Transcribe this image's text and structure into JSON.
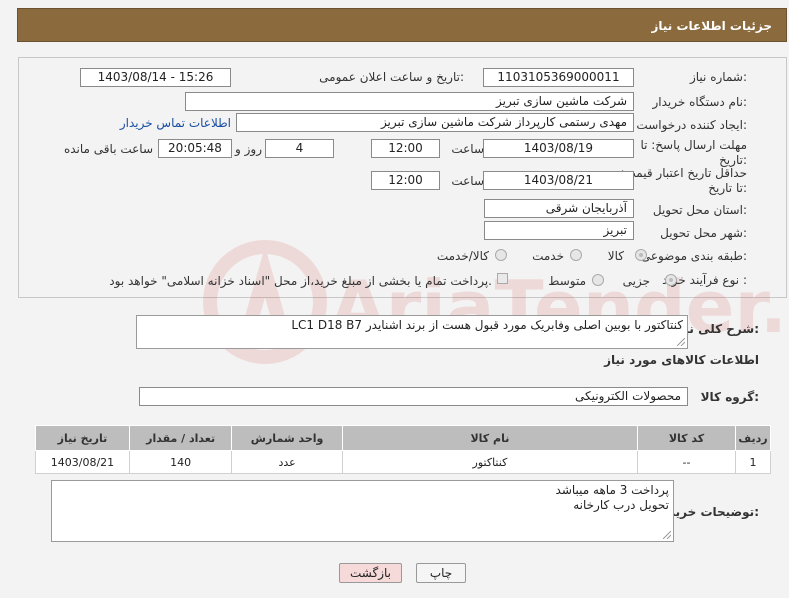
{
  "header": {
    "title": "جزئیات اطلاعات نیاز"
  },
  "form": {
    "need_number_label": "شماره نیاز:",
    "need_number": "1103105369000011",
    "announce_label": "تاریخ و ساعت اعلان عمومی:",
    "announce_value": "1403/08/14 - 15:26",
    "buyer_org_label": "نام دستگاه خریدار:",
    "buyer_org": "شرکت ماشین سازی تبریز",
    "creator_label": "ایجاد کننده درخواست:",
    "creator": "مهدی رستمی کارپرداز شرکت ماشین سازی تبریز",
    "contact_link": "اطلاعات تماس خریدار",
    "deadline_label": "مهلت ارسال پاسخ: تا تاریخ:",
    "deadline_date": "1403/08/19",
    "time_label": "ساعت",
    "deadline_time": "12:00",
    "days_value": "4",
    "days_label": "روز و",
    "remaining_value": "20:05:48",
    "remaining_label": "ساعت باقی مانده",
    "validity_label": "حداقل تاریخ اعتبار قیمت: تا تاریخ:",
    "validity_date": "1403/08/21",
    "validity_time": "12:00",
    "province_label": "استان محل تحویل:",
    "province": "آذربایجان شرقی",
    "city_label": "شهر محل تحویل:",
    "city": "تبریز",
    "category_label": "طبقه بندی موضوعی:",
    "category_options": [
      "کالا",
      "خدمت",
      "کالا/خدمت"
    ],
    "purchase_type_label": "نوع فرآیند خرید :",
    "purchase_options": [
      "جزیی",
      "متوسط"
    ],
    "treasury_text": "پرداخت تمام یا بخشی از مبلغ خرید،از محل \"اسناد خزانه اسلامی\" خواهد بود."
  },
  "description": {
    "label": "شرح کلی نیاز:",
    "text": "کنتاکتور با بوبین اصلی وفابریک مورد قبول هست از برند اشنایدر LC1 D18 B7"
  },
  "goods": {
    "section_title": "اطلاعات کالاهای مورد نیاز",
    "group_label": "گروه کالا:",
    "group_value": "محصولات الکترونیکی",
    "columns": [
      "ردیف",
      "کد کالا",
      "نام کالا",
      "واحد شمارش",
      "تعداد / مقدار",
      "تاریخ نیاز"
    ],
    "rows": [
      {
        "row": "1",
        "code": "--",
        "name": "کنتاکتور",
        "unit": "عدد",
        "qty": "140",
        "date": "1403/08/21"
      }
    ]
  },
  "buyer_notes": {
    "label": "توضیحات خریدار:",
    "line1": "پرداخت 3 ماهه میباشد",
    "line2": "تحویل درب کارخانه"
  },
  "buttons": {
    "print": "چاپ",
    "back": "بازگشت"
  },
  "watermark": {
    "text": "AriaTender.neT"
  },
  "colors": {
    "header_bg": "#8b6b3e",
    "link": "#1a4fa3",
    "back_button_bg": "#f6d9d9"
  }
}
